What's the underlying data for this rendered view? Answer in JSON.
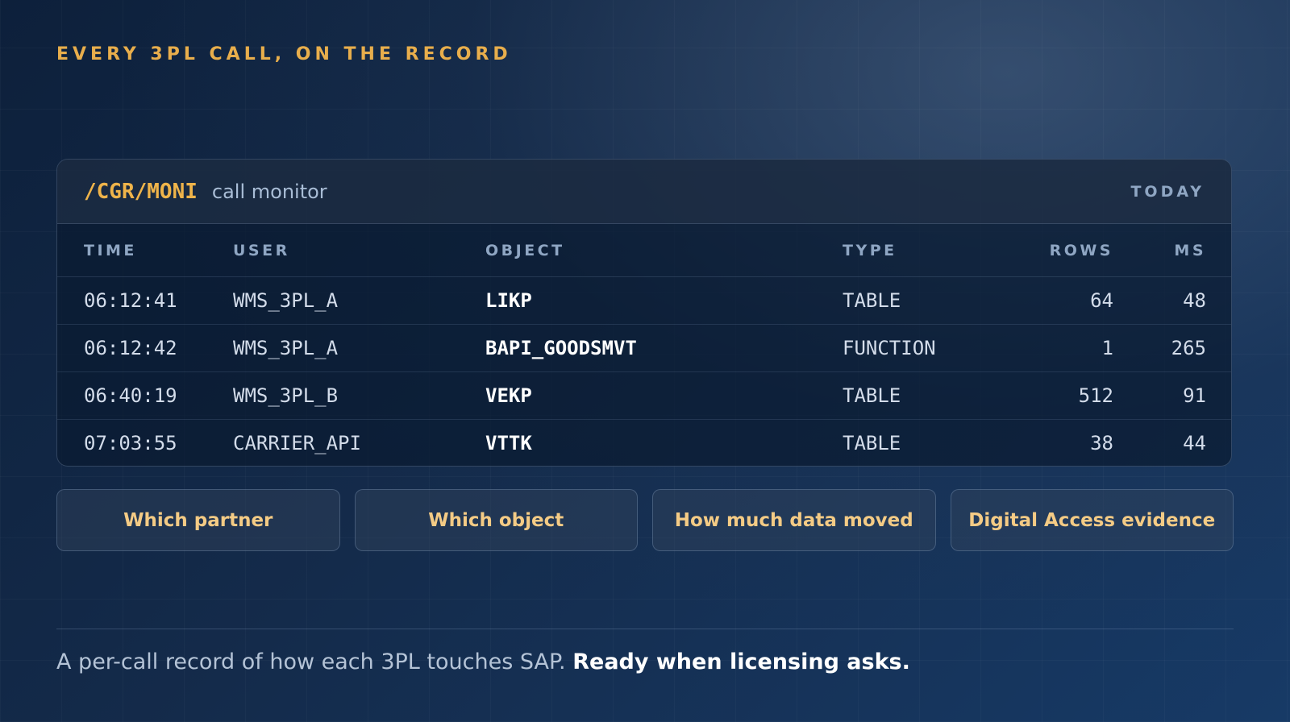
{
  "eyebrow": "EVERY 3PL CALL, ON THE RECORD",
  "monitor": {
    "tcode": "/CGR/MONI",
    "title": "call monitor",
    "period": "TODAY",
    "columns": [
      "TIME",
      "USER",
      "OBJECT",
      "TYPE",
      "ROWS",
      "MS"
    ],
    "rows": [
      {
        "time": "06:12:41",
        "user": "WMS_3PL_A",
        "object": "LIKP",
        "type": "TABLE",
        "rows": "64",
        "ms": "48"
      },
      {
        "time": "06:12:42",
        "user": "WMS_3PL_A",
        "object": "BAPI_GOODSMVT",
        "type": "FUNCTION",
        "rows": "1",
        "ms": "265"
      },
      {
        "time": "06:40:19",
        "user": "WMS_3PL_B",
        "object": "VEKP",
        "type": "TABLE",
        "rows": "512",
        "ms": "91"
      },
      {
        "time": "07:03:55",
        "user": "CARRIER_API",
        "object": "VTTK",
        "type": "TABLE",
        "rows": "38",
        "ms": "44"
      }
    ]
  },
  "chips": [
    "Which partner",
    "Which object",
    "How much data moved",
    "Digital Access evidence"
  ],
  "footer": {
    "lead": "A per-call record of how each 3PL touches SAP.",
    "emphasis": "Ready when licensing asks."
  },
  "colors": {
    "accent": "#e8ae4c",
    "chip_text": "#f4cb85",
    "background": "#142b4b"
  }
}
